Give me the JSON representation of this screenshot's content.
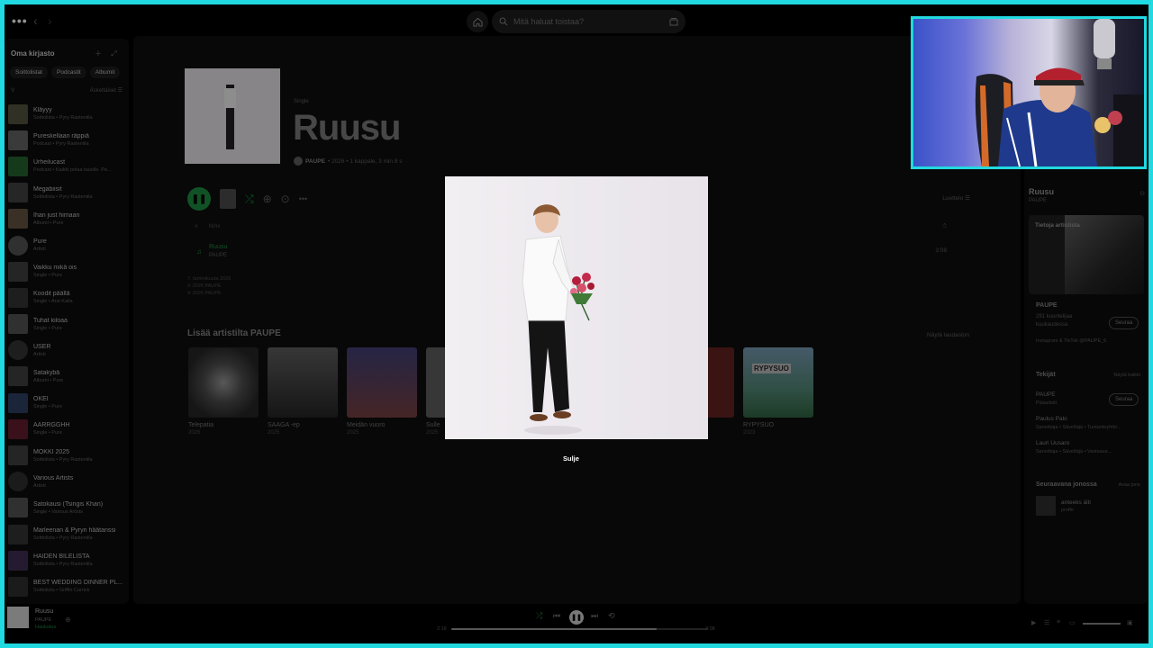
{
  "topbar": {
    "menu_dots": "•••",
    "back": "‹",
    "forward": "›",
    "search_placeholder": "Mitä haluat toistaa?"
  },
  "sidebar": {
    "title": "Oma kirjasto",
    "chips": [
      "Soittolistat",
      "Podcastit",
      "Albumit"
    ],
    "sort_label": "Äskettäiset",
    "items": [
      {
        "title": "Kläyyy",
        "sub": "Soittolista • Pyry Rasteniila",
        "color": "#4a4a3a"
      },
      {
        "title": "Pureskellaan räppiä",
        "sub": "Podcast • Pyry Rasteniila",
        "color": "#5a5a5a"
      },
      {
        "title": "Urheilucast",
        "sub": "Podcast • Kaikki pelaa tauolle. Pe...",
        "color": "#1f5a2a"
      },
      {
        "title": "Megabiisit",
        "sub": "Soittolista • Pyry Rasteniila",
        "color": "#3b3b3b"
      },
      {
        "title": "Ihan just himaan",
        "sub": "Albumi • Pure",
        "color": "#5a4a3a"
      },
      {
        "title": "Pure",
        "sub": "Artisti",
        "color": "#4a4a4a",
        "round": true
      },
      {
        "title": "Vaikku mikä ois",
        "sub": "Single • Pure",
        "color": "#3a3a3a"
      },
      {
        "title": "Koodit päällä",
        "sub": "Single • Arai Kaila",
        "color": "#2e2e2e"
      },
      {
        "title": "Tuhat kiloaa",
        "sub": "Single • Pure",
        "color": "#4a4a4a"
      },
      {
        "title": "USER",
        "sub": "Artisti",
        "color": "#2e2e2e",
        "round": true
      },
      {
        "title": "Satakybä",
        "sub": "Albumi • Pure",
        "color": "#3a3a3a"
      },
      {
        "title": "OKEI",
        "sub": "Single • Pure",
        "color": "#2a3a5a"
      },
      {
        "title": "AARRGGHH",
        "sub": "Single • Pure",
        "color": "#5a1a2a"
      },
      {
        "title": "MÖKKI 2025",
        "sub": "Soittolista • Pyry Rasteniila",
        "color": "#3a3a3a"
      },
      {
        "title": "Various Artists",
        "sub": "Artisti",
        "color": "#2a2a2a",
        "round": true
      },
      {
        "title": "Satokausi (Tsingis Khan)",
        "sub": "Single • Various Artists",
        "color": "#4a4a4a"
      },
      {
        "title": "Marleenan & Pyryn häätanssi",
        "sub": "Soittolista • Pyry Rasteniila",
        "color": "#2e2e2e"
      },
      {
        "title": "HÄIDEN BILELISTA",
        "sub": "Soittolista • Pyry Rasteniila",
        "color": "#3a2a4a"
      },
      {
        "title": "BEST WEDDING DINNER PL...",
        "sub": "Soittolista • Griffin Carrick",
        "color": "#2a2a2a"
      }
    ]
  },
  "album": {
    "type": "Single",
    "title": "Ruusu",
    "artist": "PAUPE",
    "meta_rest": "• 2026 • 1 kappale, 3 min 8 s",
    "list_view": "Luettelo",
    "col_num": "#",
    "col_title": "Nimi",
    "col_time_icon": "⏱",
    "track": {
      "num": "♫",
      "title": "Ruusu",
      "artist": "PAUPE",
      "duration": "3:08"
    },
    "release_lines": [
      "7. tammikuuta 2026",
      "© 2026 PAUPE",
      "℗ 2026 PAUPE"
    ],
    "more_title": "Lisää artistilta PAUPE",
    "show_all": "Näytä laudaston",
    "cards": [
      {
        "title": "Telepatia",
        "year": "2026",
        "color": "#555"
      },
      {
        "title": "SAAGA -ep",
        "year": "2025",
        "color": "#3a3a3a"
      },
      {
        "title": "Meidän vuoro",
        "year": "2025",
        "color": "#3a3658"
      },
      {
        "title": "Sulle",
        "year": "2025",
        "color": "#555"
      },
      {
        "title": "",
        "year": "",
        "color": "#5a2020"
      },
      {
        "title": "RYPYSUO",
        "year": "2023",
        "color": "#2a4a3a"
      }
    ],
    "card6_label": "RYPYSUO"
  },
  "right_panel": {
    "title": "Ruusu",
    "subtitle": "PAUPE",
    "about_label": "Tietoja artistista",
    "artist": "PAUPE",
    "listeners": "291 kuuntelijaa kuukaudessa",
    "follow": "Seuraa",
    "socials": "Instagram & TikTok @PAUPE_6",
    "credits_label": "Tekijät",
    "credits_show_all": "Näytä kaikki",
    "credits": [
      {
        "name": "PAUPE",
        "role": "Pääartisti"
      },
      {
        "name": "Paulus Palo",
        "role": "Sanoittaja • Säveltäjä • Tuotantoyhtiö..."
      },
      {
        "name": "Lauri Uusaro",
        "role": "Sanoittaja • Säveltäjä • Vastaava..."
      }
    ],
    "queue_label": "Seuraavana jonossa",
    "queue_open": "Avaa jono",
    "queue_item": {
      "title": "anteeks äiti",
      "artist": "proffe"
    }
  },
  "player": {
    "title": "Ruusu",
    "artist": "PAUPE",
    "device": "Haukotus",
    "time_elapsed": "2:16",
    "time_total": "3:08",
    "progress": 0.8
  },
  "overlay": {
    "close_label": "Sulje"
  },
  "colors": {
    "frame": "#21d9e0",
    "accent_green": "#1db954"
  }
}
